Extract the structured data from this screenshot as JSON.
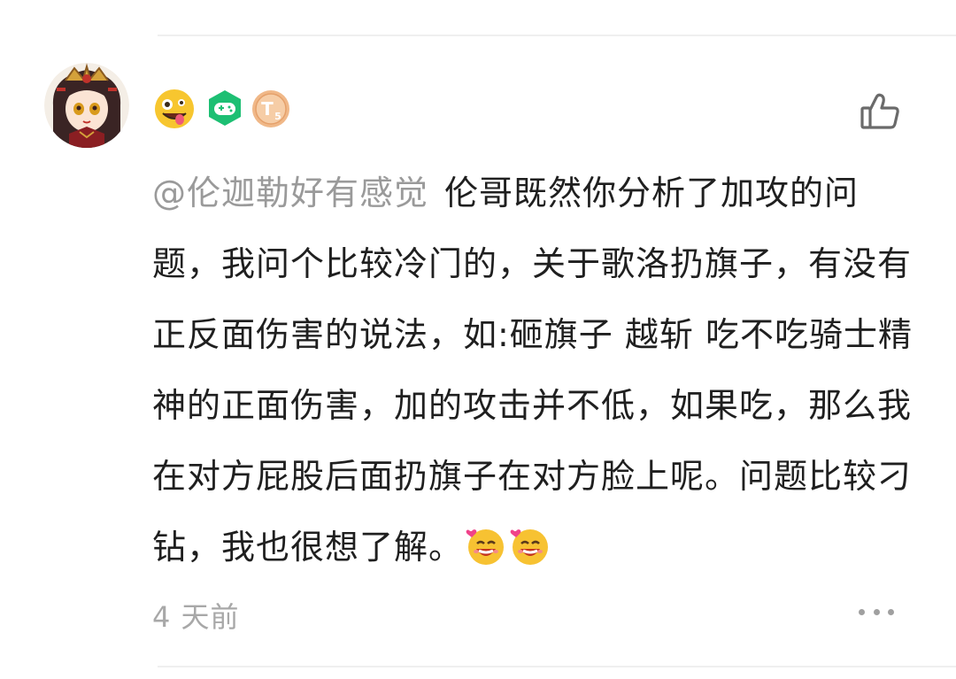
{
  "comment": {
    "mention": "@伦迦勒好有感觉",
    "text": "伦哥既然你分析了加攻的问题，我问个比较冷门的，关于歌洛扔旗子，有没有正反面伤害的说法，如:砸旗子 越斩 吃不吃骑士精神的正面伤害，加的攻击并不低，如果吃，那么我在对方屁股后面扔旗子在对方脸上呢。问题比较刁钻，我也很想了解。",
    "emojis": [
      "heart-smile-emoji-icon",
      "heart-smile-emoji-icon"
    ],
    "time": "4 天前"
  },
  "badges": [
    {
      "name": "crazy-face-emoji-icon",
      "color": "#f7c62f"
    },
    {
      "name": "game-controller-badge-icon",
      "color": "#1dbf73"
    },
    {
      "name": "coin-t5-badge-icon",
      "color": "#f0b888",
      "label": "T5"
    }
  ],
  "colors": {
    "text": "#1f1f1f",
    "mention": "#9a9a9a",
    "meta": "#a8a8a8"
  }
}
